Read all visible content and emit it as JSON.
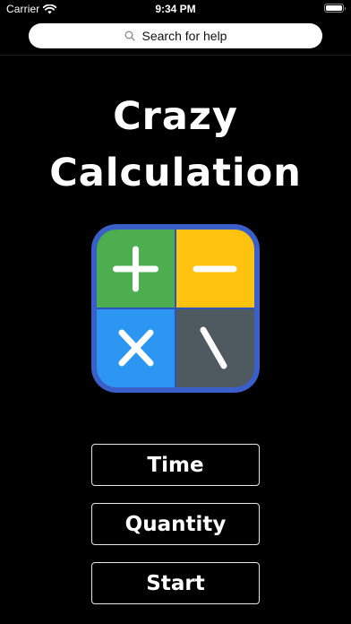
{
  "status_bar": {
    "carrier": "Carrier",
    "time": "9:34 PM",
    "icons": [
      "wifi-icon",
      "battery-icon"
    ]
  },
  "search": {
    "placeholder": "Search for help",
    "icon": "search-icon"
  },
  "title": {
    "line1": "Crazy",
    "line2": "Calculation"
  },
  "app_icon": {
    "symbols": [
      "+",
      "−",
      "×",
      "\\"
    ],
    "colors": {
      "frame": "#3a5fc9",
      "plus": "#4cae4f",
      "minus": "#ffc20e",
      "times": "#2d96f3",
      "divide": "#4e5a60"
    }
  },
  "menu": {
    "time_label": "Time",
    "quantity_label": "Quantity",
    "start_label": "Start"
  }
}
